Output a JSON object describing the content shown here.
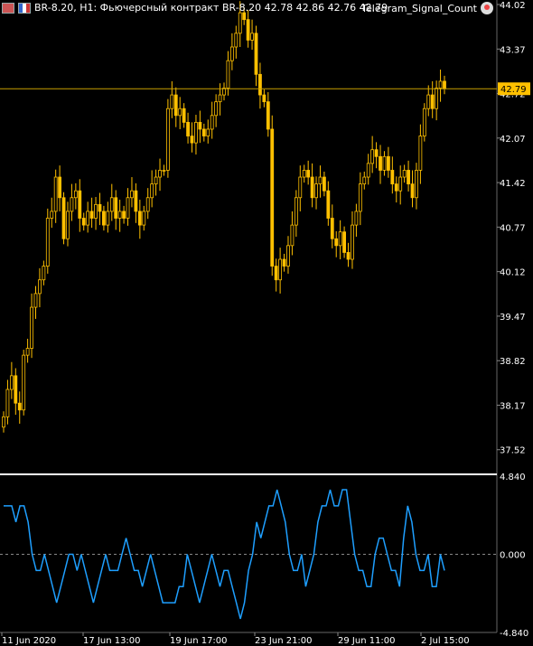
{
  "header": {
    "symbol_line": "BR-8.20, H1:  Фьючерсный контракт BR-8.20  42.78 42.86 42.76 42.79",
    "ea_name": "Telegram_Signal_Count"
  },
  "colors": {
    "background": "#000000",
    "candles": "#FFC000",
    "price_line": "#C8A000",
    "price_tag_bg": "#FFC000",
    "indicator": "#1E9FFF",
    "zero_line": "#888888",
    "axis_text": "#FFFFFF",
    "separator": "#FFFFFF"
  },
  "chart_data": [
    {
      "type": "candlestick",
      "current_price_label": "42.79",
      "current_price": 42.79,
      "y_tick_labels": [
        "44.02",
        "43.37",
        "42.72",
        "42.07",
        "41.42",
        "40.77",
        "40.12",
        "39.47",
        "38.82",
        "38.17",
        "37.52"
      ],
      "ylim": [
        37.2,
        44.02
      ],
      "closes": [
        38.0,
        38.4,
        38.6,
        38.2,
        38.1,
        38.9,
        39.0,
        39.6,
        39.8,
        40.0,
        40.2,
        40.9,
        41.0,
        41.5,
        41.2,
        40.6,
        41.0,
        41.2,
        41.3,
        40.9,
        40.8,
        41.0,
        40.9,
        41.1,
        41.0,
        40.8,
        41.0,
        41.2,
        40.9,
        41.0,
        40.9,
        41.2,
        41.3,
        41.0,
        40.8,
        41.0,
        41.2,
        41.4,
        41.5,
        41.6,
        41.6,
        42.5,
        42.7,
        42.4,
        42.5,
        42.3,
        42.1,
        42.0,
        42.3,
        42.2,
        42.1,
        42.2,
        42.4,
        42.6,
        42.7,
        42.8,
        43.2,
        43.4,
        43.6,
        43.9,
        43.8,
        43.5,
        43.6,
        43.0,
        42.7,
        42.6,
        42.2,
        40.2,
        40.0,
        40.3,
        40.2,
        40.5,
        40.8,
        41.2,
        41.5,
        41.6,
        41.5,
        41.2,
        41.4,
        41.5,
        41.3,
        40.9,
        40.6,
        40.5,
        40.7,
        40.4,
        40.3,
        40.8,
        41.0,
        41.4,
        41.5,
        41.7,
        41.9,
        41.8,
        41.6,
        41.8,
        41.6,
        41.4,
        41.3,
        41.5,
        41.6,
        41.4,
        41.2,
        41.6,
        42.1,
        42.5,
        42.7,
        42.5,
        42.8,
        42.9,
        42.79
      ]
    },
    {
      "type": "line",
      "y_tick_labels": [
        "4.840",
        "0.000",
        "-4.840"
      ],
      "ylim": [
        -4.84,
        4.84
      ],
      "values": [
        3,
        3,
        3,
        2,
        3,
        3,
        2,
        0,
        -1,
        -1,
        0,
        -1,
        -2,
        -3,
        -2,
        -1,
        0,
        0,
        -1,
        0,
        -1,
        -2,
        -3,
        -2,
        -1,
        0,
        -1,
        -1,
        -1,
        0,
        1,
        0,
        -1,
        -1,
        -2,
        -1,
        0,
        -1,
        -2,
        -3,
        -3,
        -3,
        -3,
        -2,
        -2,
        0,
        -1,
        -2,
        -3,
        -2,
        -1,
        0,
        -1,
        -2,
        -1,
        -1,
        -2,
        -3,
        -4,
        -3,
        -1,
        0,
        2,
        1,
        2,
        3,
        3,
        4,
        3,
        2,
        0,
        -1,
        -1,
        0,
        -2,
        -1,
        0,
        2,
        3,
        3,
        4,
        3,
        3,
        4,
        4,
        2,
        0,
        -1,
        -1,
        -2,
        -2,
        0,
        1,
        1,
        0,
        -1,
        -1,
        -2,
        1,
        3,
        2,
        0,
        -1,
        -1,
        0,
        -2,
        -2,
        0,
        -1
      ],
      "x_tick_labels": [
        "11 Jun 2020",
        "17 Jun 13:00",
        "19 Jun 17:00",
        "23 Jun 21:00",
        "29 Jun 11:00",
        "2 Jul 15:00"
      ]
    }
  ]
}
